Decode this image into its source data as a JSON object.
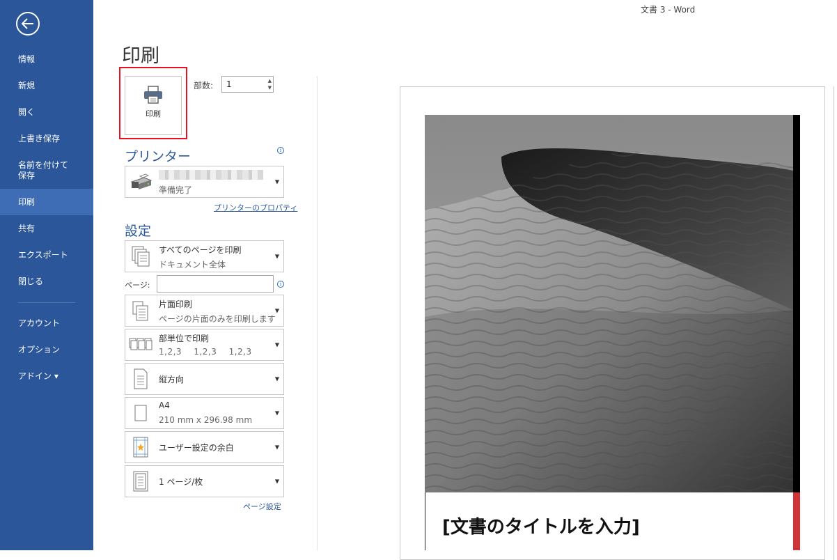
{
  "window": {
    "title": "文書 3 - Word"
  },
  "sidebar": {
    "items": [
      {
        "label": "情報"
      },
      {
        "label": "新規"
      },
      {
        "label": "開く"
      },
      {
        "label": "上書き保存"
      },
      {
        "label": "名前を付けて\n保存"
      },
      {
        "label": "印刷"
      },
      {
        "label": "共有"
      },
      {
        "label": "エクスポート"
      },
      {
        "label": "閉じる"
      },
      {
        "label": "アカウント"
      },
      {
        "label": "オプション"
      },
      {
        "label": "アドイン ▾"
      }
    ],
    "active_index": 5
  },
  "page": {
    "title": "印刷"
  },
  "print_button": {
    "label": "印刷"
  },
  "copies": {
    "label": "部数:",
    "value": "1"
  },
  "printer": {
    "header": "プリンター",
    "status": "準備完了",
    "properties_link": "プリンターのプロパティ"
  },
  "settings": {
    "header": "設定",
    "print_range": {
      "title": "すべてのページを印刷",
      "subtitle": "ドキュメント全体"
    },
    "pages_label": "ページ:",
    "sides": {
      "title": "片面印刷",
      "subtitle": "ページの片面のみを印刷します"
    },
    "collation": {
      "title": "部単位で印刷",
      "subtitle": "1,2,3    1,2,3    1,2,3"
    },
    "orientation": {
      "title": "縦方向"
    },
    "paper": {
      "title": "A4",
      "subtitle": "210 mm x 296.98 mm"
    },
    "margins": {
      "title": "ユーザー設定の余白"
    },
    "pages_per_sheet": {
      "title": "1 ページ/枚"
    },
    "page_setup_link": "ページ設定"
  },
  "preview": {
    "doc_title": "[文書のタイトルを入力]"
  },
  "colors": {
    "sidebar": "#2b579a",
    "sidebar_active": "#3e6db5",
    "highlight": "#e81123",
    "accent_bar": "#d13438"
  }
}
